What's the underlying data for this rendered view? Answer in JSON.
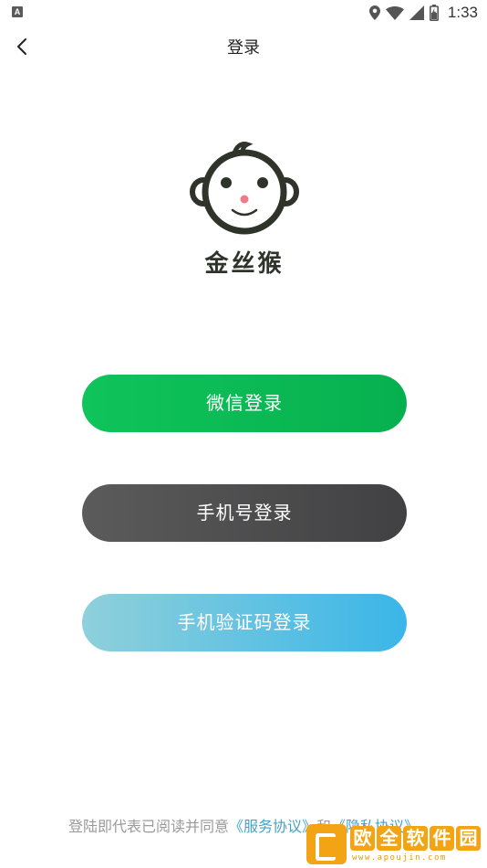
{
  "status_bar": {
    "time": "1:33",
    "notification_letter": "A",
    "icons": [
      "location-icon",
      "wifi-icon",
      "signal-icon",
      "battery-icon"
    ]
  },
  "header": {
    "title": "登录",
    "back_icon": "chevron-left-icon"
  },
  "logo": {
    "brand_text": "金丝猴"
  },
  "buttons": {
    "wechat_login": "微信登录",
    "phone_login": "手机号登录",
    "sms_login": "手机验证码登录"
  },
  "agreement": {
    "prefix": "登陆即代表已阅读并同意",
    "service_link": "《服务协议》",
    "conjunction": "和",
    "privacy_link": "《隐私协议》"
  },
  "watermark": {
    "chars": [
      "欧",
      "全",
      "软",
      "件",
      "园"
    ],
    "url": "www.apoujin.com"
  },
  "colors": {
    "wechat_green": "#0fc45a",
    "phone_dark": "#4d4d4f",
    "sms_blue": "#3ab6e8",
    "link_blue": "#47a3c4",
    "watermark_orange": "#f2a415"
  }
}
